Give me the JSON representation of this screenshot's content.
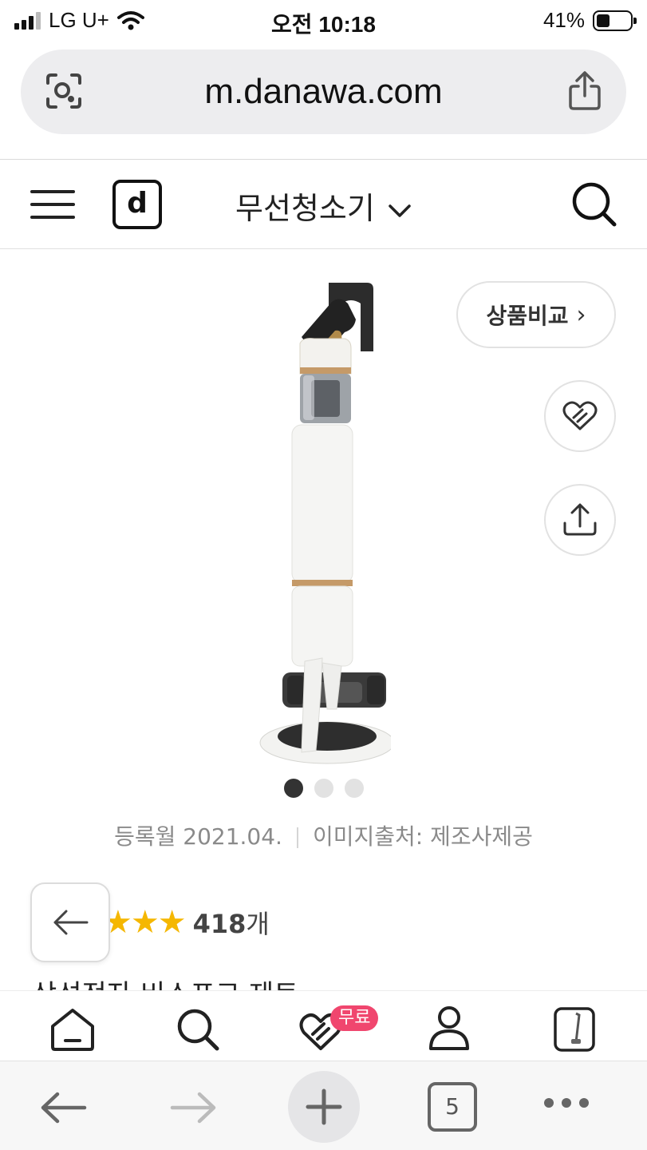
{
  "status_bar": {
    "carrier": "LG U+",
    "time": "오전 10:18",
    "battery_percent_label": "41%",
    "battery_level": 0.41
  },
  "browser": {
    "url": "m.danawa.com",
    "tab_count": "5"
  },
  "site_header": {
    "logo": "d",
    "category": "무선청소기"
  },
  "product": {
    "compare_label": "상품비교",
    "compare_arrow": "›",
    "image_count": 3,
    "active_image": 1,
    "registered": "등록월 2021.04.",
    "image_source": "이미지출처: 제조사제공",
    "stars": "★★★",
    "review_count": "418",
    "review_unit": "개",
    "title_peek": "삼성전자 비스포크 제트"
  },
  "site_nav": {
    "badge": "무료"
  },
  "colors": {
    "star": "#f5b700",
    "badge": "#f0466e"
  }
}
